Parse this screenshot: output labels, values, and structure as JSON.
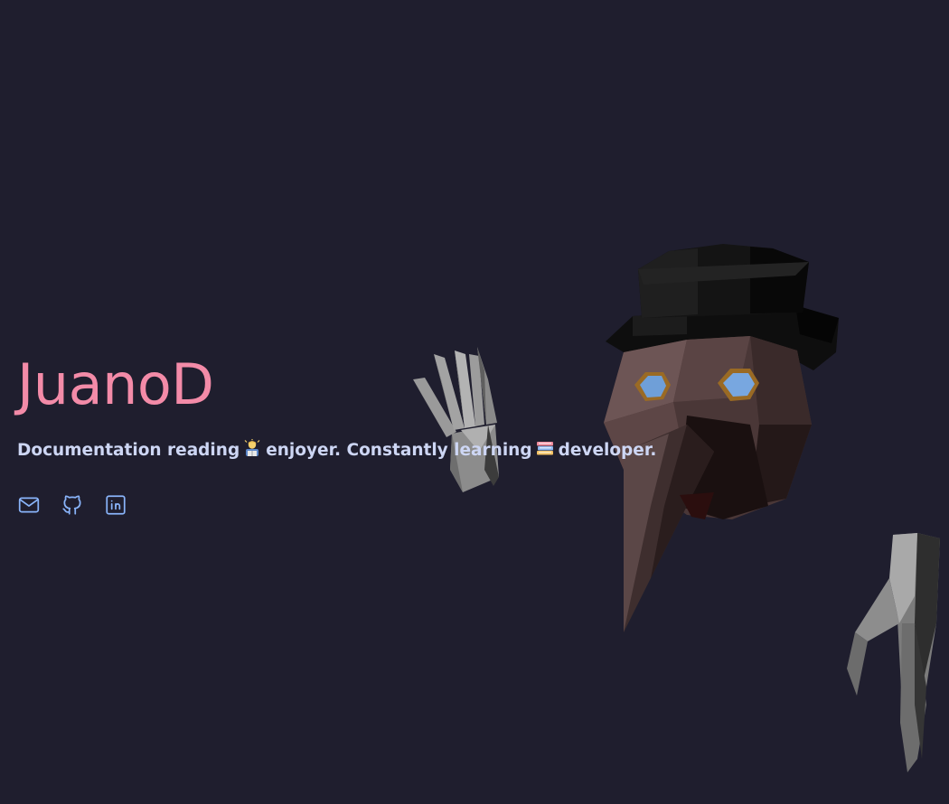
{
  "profile": {
    "name": "JuanoD",
    "tagline": {
      "part1": "Documentation reading",
      "emoji1": "reading-person-emoji",
      "part2": "enjoyer. Constantly learning",
      "emoji2": "books-emoji",
      "part3": "developer."
    }
  },
  "links": [
    {
      "icon": "mail-icon"
    },
    {
      "icon": "github-icon"
    },
    {
      "icon": "linkedin-icon"
    }
  ],
  "colors": {
    "background": "#1f1e2e",
    "accent": "#f38ba8",
    "text": "#cdd6f4",
    "icon": "#89b4fa"
  }
}
